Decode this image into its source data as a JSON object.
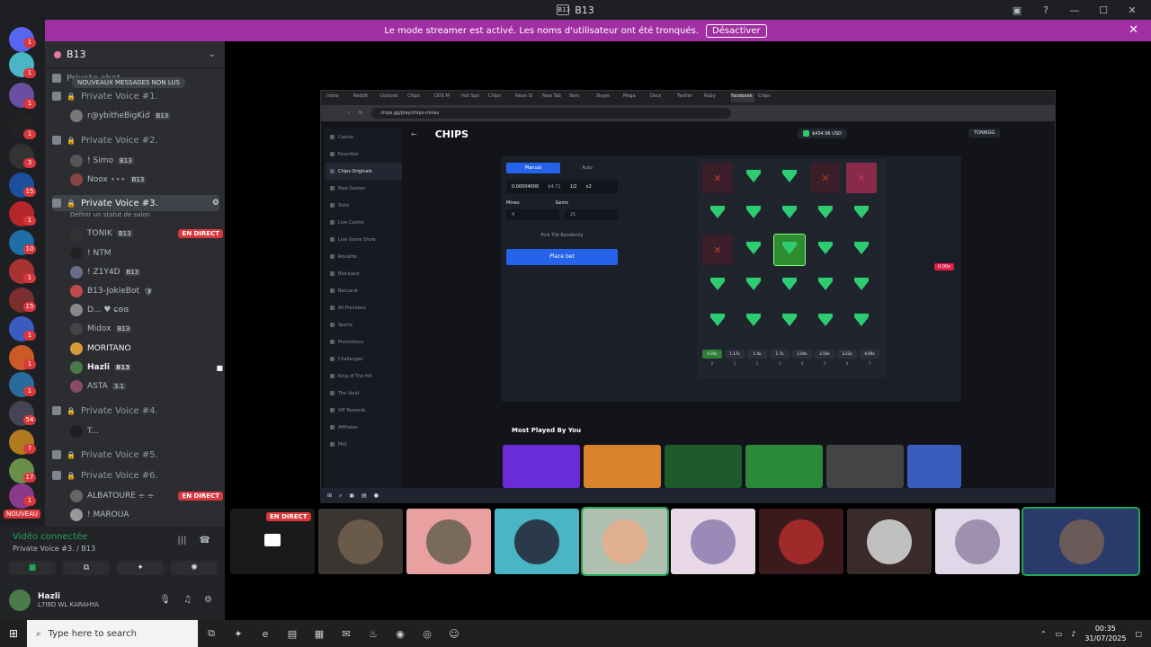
{
  "window": {
    "title": "B13"
  },
  "banner": {
    "text": "Le mode streamer est activé. Les noms d'utilisateur ont été tronqués.",
    "button": "Désactiver"
  },
  "server": {
    "name": "B13",
    "new_messages": "NOUVEAUX MESSAGES NON LUS"
  },
  "guild_badges": [
    "1",
    "1",
    "1",
    "1",
    "3",
    "15",
    "1",
    "10",
    "1",
    "15",
    "1",
    "1",
    "1",
    "54",
    "7",
    "17",
    "1"
  ],
  "guild_new": "NOUVEAU",
  "channels": [
    {
      "label": "Private chat",
      "top": 0
    },
    {
      "label": "Private Voice #1."
    },
    {
      "label": "Private Voice #2."
    },
    {
      "label": "Private Voice #3."
    },
    {
      "label": "Private Voice #4."
    },
    {
      "label": "Private Voice #5."
    },
    {
      "label": "Private Voice #6."
    }
  ],
  "status_text": "Définir un statut de salon",
  "users": {
    "v1": [
      {
        "name": "r@ybitheBigKid",
        "tag": "B13"
      }
    ],
    "v2": [
      {
        "name": "! Simo",
        "tag": "B13"
      },
      {
        "name": "Noox ⋆⋆⋆",
        "tag": "B13"
      }
    ],
    "v3": [
      {
        "name": "TONIK",
        "tag": "B13",
        "live": "EN DIRECT"
      },
      {
        "name": "! NTM",
        "tag": ""
      },
      {
        "name": "! Z1Y4D",
        "tag": "B13"
      },
      {
        "name": "B13-JokieBot",
        "tag": ""
      },
      {
        "name": "D... ♥ ɕɞɞ",
        "tag": ""
      },
      {
        "name": "Midox",
        "tag": "B13"
      },
      {
        "name": "MORITANO",
        "tag": ""
      },
      {
        "name": "Hazli",
        "tag": "B13"
      },
      {
        "name": "ASTA",
        "tag": "3.1"
      }
    ],
    "v4": [
      {
        "name": "T...",
        "tag": ""
      }
    ],
    "v6": [
      {
        "name": "ALBATOURE ⌯ ⌯",
        "tag": "",
        "live": "EN DIRECT"
      },
      {
        "name": "! MAROUA",
        "tag": ""
      }
    ]
  },
  "voice_panel": {
    "connected": "Vidéo connectée",
    "channel": "Private Voice #3. / B13",
    "user_name": "Hazli",
    "user_sub": "L7I9D WL KARAHYA"
  },
  "browser": {
    "url": "chips.gg/play/chips-mines",
    "tabs": [
      "Inbox",
      "Reddit",
      "Outlook",
      "Chips",
      "DDS M",
      "Hot Spo",
      "Chips",
      "Neon Sl",
      "New Tab",
      "Sero",
      "Skype",
      "Mega",
      "Docs",
      "Twitter",
      "Ruby",
      "Facebook",
      "Chips"
    ]
  },
  "site": {
    "brand": "CHIPS",
    "balance": "$434.96",
    "currency": "USD",
    "username": "TONIKGG",
    "sidebar": [
      "Casino",
      "Favorites",
      "Chips Originals",
      "New Games",
      "Slots",
      "Live Casino",
      "Live Game Show",
      "Roulette",
      "Blackjack",
      "Baccarat",
      "All Providers",
      "Sports",
      "Promotions",
      "Challenges",
      "King of The Hill",
      "The Vault",
      "VIP Rewards",
      "Affiliates",
      "FAQ"
    ],
    "game": {
      "manual": "Manual",
      "auto": "Auto",
      "bet_amount": "0.00004000",
      "bet_usd": "$4.71",
      "half": "1/2",
      "double": "x2",
      "mines_label": "Mines",
      "gems_label": "Gems",
      "mines_value": "4",
      "gems_value": "21",
      "pick_random": "Pick Tile Randomly",
      "place_bet": "Place bet",
      "payout": "0.00x",
      "multipliers": [
        "0.00x",
        "1.17x",
        "1.4x",
        "1.7x",
        "2.00x",
        "2.50x",
        "3.22x",
        "4.09x"
      ],
      "counts": [
        "0",
        "1",
        "2",
        "3",
        "4",
        "5",
        "6",
        "7"
      ],
      "grid": [
        [
          "x",
          "gem",
          "gem",
          "x",
          "pink"
        ],
        [
          "gem",
          "gem",
          "gem",
          "gem",
          "gem"
        ],
        [
          "x",
          "gem",
          "sel",
          "gem",
          "gem"
        ],
        [
          "gem",
          "gem",
          "gem",
          "gem",
          "gem"
        ],
        [
          "gem",
          "gem",
          "gem",
          "gem",
          "gem"
        ]
      ]
    },
    "most_played": "Most Played By You"
  },
  "tiles": {
    "live": "EN DIRECT"
  },
  "taskbar": {
    "search_placeholder": "Type here to search",
    "time": "00:35",
    "date": "31/07/2025"
  }
}
